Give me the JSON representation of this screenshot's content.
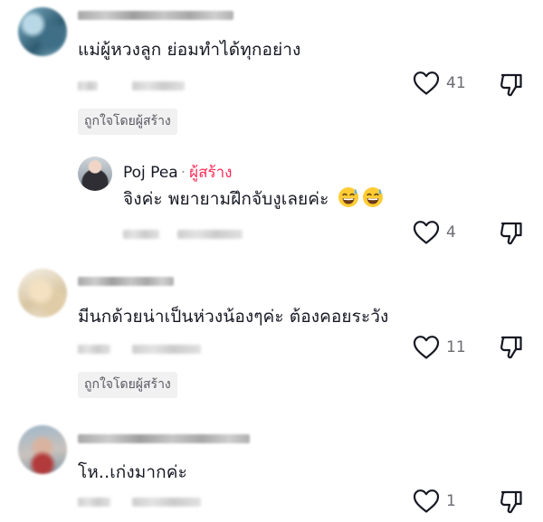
{
  "comments": [
    {
      "text": "แม่ผู้หวงลูก ย่อมทำได้ทุกอย่าง",
      "likes": "41",
      "badge": "ถูกใจโดยผู้สร้าง",
      "reply": {
        "author": "Poj Pea",
        "separator": "·",
        "creator_label": "ผู้สร้าง",
        "text": "จิงค่ะ พยายามฝึกจับงูเลยค่ะ",
        "emojis": [
          "grinning-sweat-emoji",
          "grinning-sweat-emoji"
        ],
        "likes": "4"
      }
    },
    {
      "text": "มีนกด้วยน่าเป็นห่วงน้องๆค่ะ ต้องคอยระวัง",
      "likes": "11",
      "badge": "ถูกใจโดยผู้สร้าง"
    },
    {
      "text": "โห..เก่งมากค่ะ",
      "likes": "1"
    }
  ],
  "icons": {
    "like": "heart-outline-icon",
    "dislike": "thumbs-down-outline-icon"
  },
  "colors": {
    "creator": "#fe2c55",
    "muted": "#6b6b72",
    "badge_bg": "#f1f1f2"
  }
}
